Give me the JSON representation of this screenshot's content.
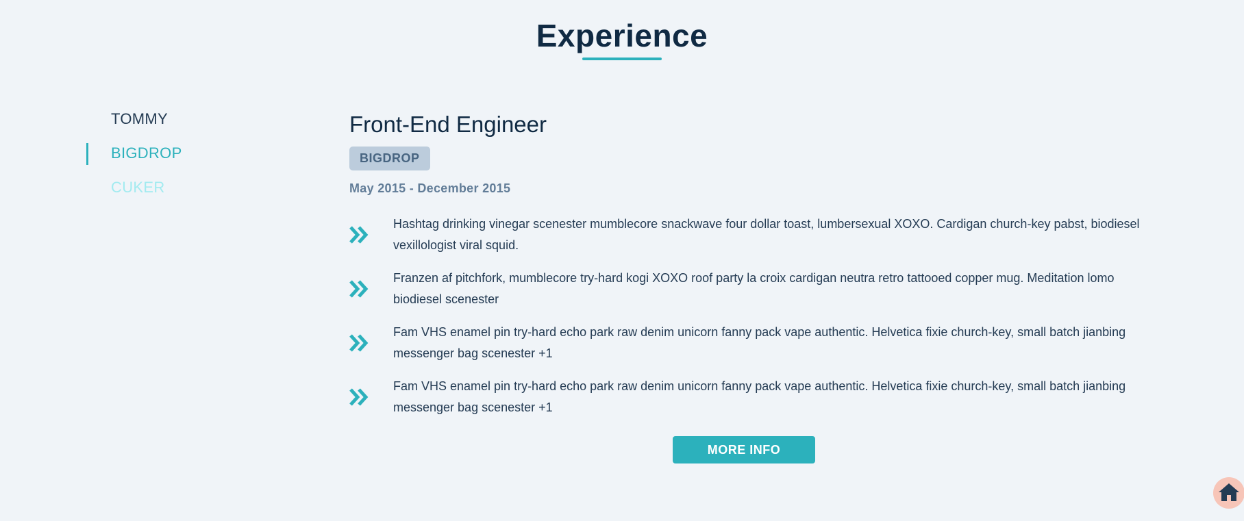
{
  "section": {
    "title": "Experience",
    "accent_color": "#2cb1bc"
  },
  "tabs": [
    {
      "label": "TOMMY",
      "active": false
    },
    {
      "label": "BIGDROP",
      "active": true
    },
    {
      "label": "CUKER",
      "active": false
    }
  ],
  "job": {
    "title": "Front-End Engineer",
    "company": "BIGDROP",
    "dates": "May 2015 - December 2015",
    "duty_icon": "double-chevron-right-icon",
    "duties": [
      "Hashtag drinking vinegar scenester mumblecore snackwave four dollar toast, lumbersexual XOXO. Cardigan church-key pabst, biodiesel vexillologist viral squid.",
      "Franzen af pitchfork, mumblecore try-hard kogi XOXO roof party la croix cardigan neutra retro tattooed copper mug. Meditation lomo biodiesel scenester",
      "Fam VHS enamel pin try-hard echo park raw denim unicorn fanny pack vape authentic. Helvetica fixie church-key, small batch jianbing messenger bag scenester +1",
      "Fam VHS enamel pin try-hard echo park raw denim unicorn fanny pack vape authentic. Helvetica fixie church-key, small batch jianbing messenger bag scenester +1"
    ]
  },
  "more_button": {
    "label": "MORE INFO"
  },
  "home_button": {
    "icon": "home-icon",
    "color": "#f7c5b8"
  }
}
